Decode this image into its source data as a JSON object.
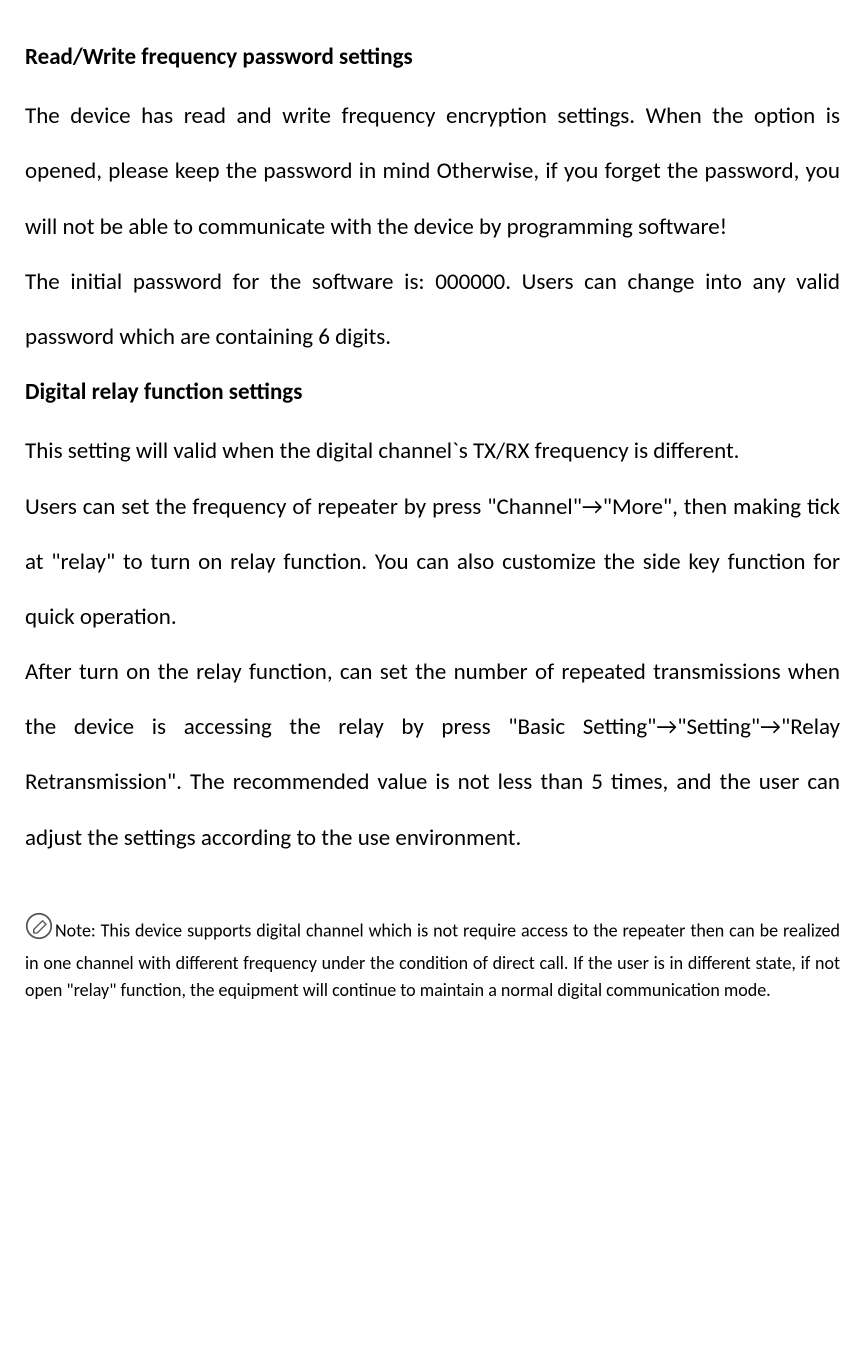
{
  "section1": {
    "heading": "Read/Write frequency password settings",
    "p1": "The device has read and write frequency encryption settings. When the option is opened, please keep the password in mind Otherwise, if you forget the password, you will not be able to communicate with the device by programming software!",
    "p2": "The initial password for the software is: 000000. Users can change into any valid password which are containing 6 digits."
  },
  "section2": {
    "heading": "Digital relay function settings",
    "p1": "This setting will valid when the digital channel`s TX/RX frequency is different.",
    "p2": "Users can set the frequency of repeater by press \"Channel\"→\"More\", then making tick at \"relay\" to turn on relay function. You can also customize the side key function for quick operation.",
    "p3": "After turn on the relay function, can set the number of repeated transmissions when the device is accessing the relay by press \"Basic Setting\"→\"Setting\"→\"Relay Retransmission\". The recommended value is not less than 5 times, and the user can adjust the settings according to the use environment."
  },
  "note": {
    "text": "Note: This device supports digital channel which is not require access to the repeater then can be realized in one channel with different frequency under the condition of direct call. If the user is in different state, if not open \"relay\" function, the equipment will continue to maintain a normal digital communication mode."
  }
}
